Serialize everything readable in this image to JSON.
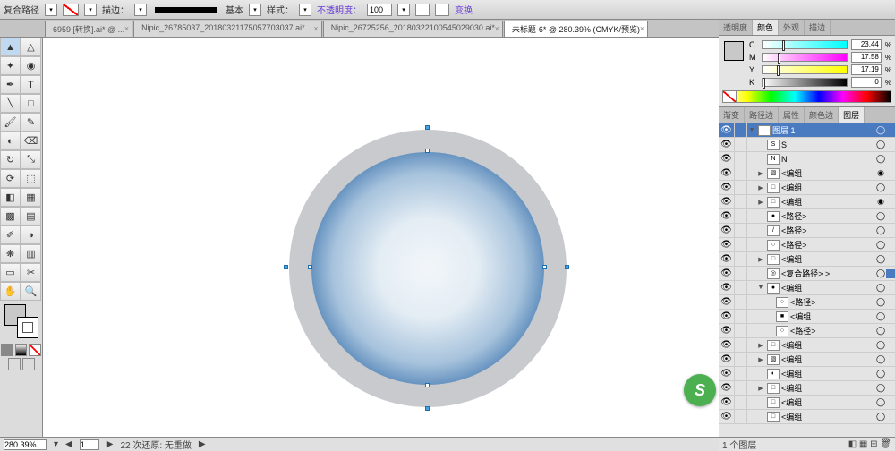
{
  "topbar": {
    "title": "复合路径",
    "stroke_lbl": "描边：",
    "basic": "基本",
    "style_lbl": "样式：",
    "opacity_lbl": "不透明度：",
    "opacity_val": "100",
    "swap": "变换"
  },
  "tabs": [
    {
      "label": "6959 [转换].ai* @ ...",
      "active": false
    },
    {
      "label": "Nipic_26785037_20180321175057703037.ai* ...",
      "active": false
    },
    {
      "label": "Nipic_26725256_20180322100545029030.ai*",
      "active": false
    },
    {
      "label": "未标题-6* @ 280.39% (CMYK/预览)",
      "active": true
    }
  ],
  "status": {
    "zoom": "280.39%",
    "page": "1",
    "undo": "22 次还原: 无重做"
  },
  "color_tabs": [
    "透明度",
    "颜色",
    "外观",
    "描边"
  ],
  "cmyk": [
    {
      "ch": "C",
      "val": "23.44"
    },
    {
      "ch": "M",
      "val": "17.58"
    },
    {
      "ch": "Y",
      "val": "17.19"
    },
    {
      "ch": "K",
      "val": "0"
    }
  ],
  "layer_tabs": [
    "渐变",
    "路径边",
    "属性",
    "颜色边",
    "图层"
  ],
  "layers": [
    {
      "d": 0,
      "tw": "▼",
      "th": "■",
      "name": "图层 1",
      "sel": true,
      "o": "◯",
      "ind": "■"
    },
    {
      "d": 1,
      "tw": "",
      "th": "S",
      "name": "S",
      "o": "◯"
    },
    {
      "d": 1,
      "tw": "",
      "th": "N",
      "name": "N",
      "o": "◯"
    },
    {
      "d": 1,
      "tw": "▶",
      "th": "▧",
      "name": "<编组",
      "o": "◉"
    },
    {
      "d": 1,
      "tw": "▶",
      "th": "□",
      "name": "<编组",
      "o": "◯"
    },
    {
      "d": 1,
      "tw": "▶",
      "th": "□",
      "name": "<编组",
      "o": "◉"
    },
    {
      "d": 1,
      "tw": "",
      "th": "●",
      "name": "<路径>",
      "o": "◯"
    },
    {
      "d": 1,
      "tw": "",
      "th": "/",
      "name": "<路径>",
      "o": "◯"
    },
    {
      "d": 1,
      "tw": "",
      "th": "○",
      "name": "<路径>",
      "o": "◯"
    },
    {
      "d": 1,
      "tw": "▶",
      "th": "□",
      "name": "<编组",
      "o": "◯"
    },
    {
      "d": 1,
      "tw": "",
      "th": "◎",
      "name": "<复合路径> >",
      "o": "◯",
      "ind": "■"
    },
    {
      "d": 1,
      "tw": "▼",
      "th": "●",
      "name": "<编组",
      "o": "◯"
    },
    {
      "d": 2,
      "tw": "",
      "th": "○",
      "name": "<路径>",
      "o": "◯"
    },
    {
      "d": 2,
      "tw": "",
      "th": "■",
      "name": "<编组",
      "o": "◯"
    },
    {
      "d": 2,
      "tw": "",
      "th": "○",
      "name": "<路径>",
      "o": "◯"
    },
    {
      "d": 1,
      "tw": "▶",
      "th": "□",
      "name": "<编组",
      "o": "◯"
    },
    {
      "d": 1,
      "tw": "▶",
      "th": "▧",
      "name": "<编组",
      "o": "◯"
    },
    {
      "d": 1,
      "tw": "",
      "th": "◐",
      "name": "<编组",
      "o": "◯"
    },
    {
      "d": 1,
      "tw": "▶",
      "th": "□",
      "name": "<编组",
      "o": "◯"
    },
    {
      "d": 1,
      "tw": "",
      "th": "□",
      "name": "<编组",
      "o": "◯"
    },
    {
      "d": 1,
      "tw": "",
      "th": "□",
      "name": "<编组",
      "o": "◯"
    }
  ],
  "layer_foot": "1 个图层"
}
